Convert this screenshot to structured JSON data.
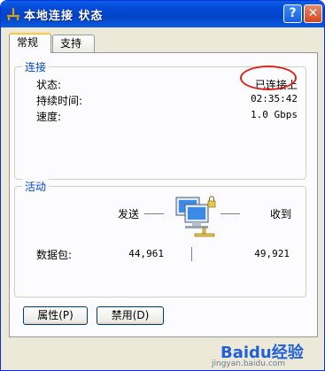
{
  "window": {
    "title": "本地连接 状态",
    "help_label": "?",
    "close_label": "✕"
  },
  "tabs": [
    {
      "label": "常规",
      "active": true
    },
    {
      "label": "支持",
      "active": false
    }
  ],
  "connection": {
    "group_title": "连接",
    "rows": [
      {
        "label": "状态:",
        "value": "已连接上"
      },
      {
        "label": "持续时间:",
        "value": "02:35:42"
      },
      {
        "label": "速度:",
        "value": "1.0 Gbps"
      }
    ]
  },
  "activity": {
    "group_title": "活动",
    "sent_label": "发送",
    "received_label": "收到",
    "packets_label": "数据包:",
    "sent_packets": "44,961",
    "received_packets": "49,921"
  },
  "buttons": {
    "properties": "属性(P)",
    "disable": "禁用(D)"
  },
  "watermark": {
    "brand": "Baidu经验",
    "url": "jingyan.baidu.com"
  },
  "colors": {
    "title_bar": "#0449d6",
    "group_title": "#0046d5",
    "annotation": "#e0201a"
  }
}
